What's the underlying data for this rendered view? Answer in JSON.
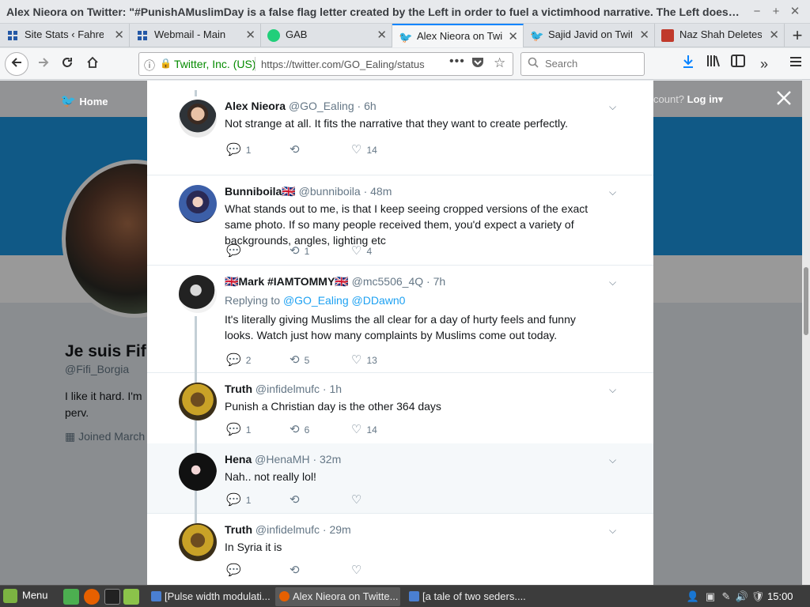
{
  "window": {
    "title": "Alex Nieora on Twitter: \"#PunishAMuslimDay is a false flag letter created by the Left in order to fuel a victimhood narrative. The Left does t…",
    "minimize": "−",
    "maximize": "+",
    "close": "✕"
  },
  "tabs": [
    {
      "label": "Site Stats ‹ Fahrenh",
      "close": "✕"
    },
    {
      "label": "Webmail - Main",
      "close": "✕"
    },
    {
      "label": "GAB",
      "close": "✕"
    },
    {
      "label": "Alex Nieora on Twi",
      "close": "✕"
    },
    {
      "label": "Sajid Javid on Twitte",
      "close": "✕"
    },
    {
      "label": "Naz Shah Deletes",
      "close": "✕"
    }
  ],
  "newtab": "+",
  "nav": {
    "site_identity": "Twitter, Inc. (US)",
    "url": "https://twitter.com/GO_Ealing/status",
    "page_actions": "•••",
    "search_placeholder": "Search"
  },
  "twitter": {
    "home": "Home",
    "account_prompt": "count?",
    "login": "Log in",
    "profile_name": "Je suis Fifi",
    "profile_handle": "@Fifi_Borgia",
    "profile_bio": "I like it hard. I'm perv.",
    "profile_joined": "Joined March"
  },
  "replies": [
    {
      "name": "Alex Nieora",
      "handle": "@GO_Ealing",
      "time": "· 6h",
      "replying": null,
      "text": "Not strange at all. It fits the narrative that they want to create perfectly.",
      "replies": "1",
      "retweets": "",
      "likes": "14"
    },
    {
      "name": "Bunniboila",
      "flag": "🇬🇧",
      "handle": "@bunniboila",
      "time": "· 48m",
      "replying": null,
      "text": "What stands out to me, is that I keep seeing cropped versions of the exact same photo. If so many people received them, you'd expect a variety of backgrounds, angles, lighting etc",
      "replies": "",
      "retweets": "1",
      "likes": "4"
    },
    {
      "name": "Mark #IAMTOMMY",
      "flag_pre": "🇬🇧",
      "flag": "🇬🇧",
      "handle": "@mc5506_4Q",
      "time": "· 7h",
      "replying": {
        "prefix": "Replying to",
        "mentions": [
          "@GO_Ealing",
          "@DDawn0"
        ]
      },
      "text": "It's literally giving Muslims the all clear for a day of hurty feels and funny looks. Watch just how many complaints by Muslims come out today.",
      "replies": "2",
      "retweets": "5",
      "likes": "13"
    },
    {
      "name": "Truth",
      "handle": "@infidelmufc",
      "time": "· 1h",
      "replying": null,
      "text": "Punish a Christian day is the other 364 days",
      "replies": "1",
      "retweets": "6",
      "likes": "14"
    },
    {
      "name": "Hena",
      "handle": "@HenaMH",
      "time": "· 32m",
      "replying": null,
      "text": "Nah.. not really lol!",
      "replies": "1",
      "retweets": "",
      "likes": ""
    },
    {
      "name": "Truth",
      "handle": "@infidelmufc",
      "time": "· 29m",
      "replying": null,
      "text": "In Syria it is",
      "replies": "",
      "retweets": "",
      "likes": ""
    }
  ],
  "taskbar": {
    "menu": "Menu",
    "tasks": [
      "[Pulse width modulati...",
      "Alex Nieora on Twitte...",
      "[a tale of two seders...."
    ],
    "clock": "15:00"
  },
  "icons": {
    "reply": "reply-icon",
    "retweet": "retweet-icon",
    "like": "heart-icon"
  },
  "colors": {
    "twitter_blue": "#1da1f2",
    "accent": "#0a84ff"
  }
}
